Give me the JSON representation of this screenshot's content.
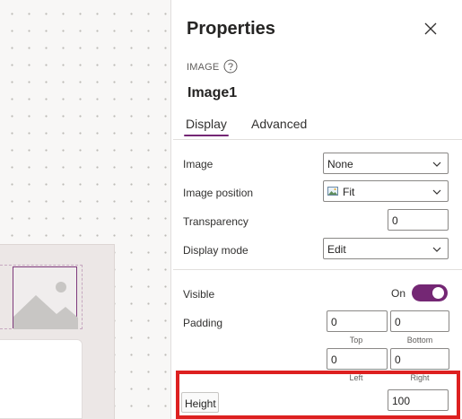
{
  "pane": {
    "title": "Properties",
    "control_type": "IMAGE",
    "control_name": "Image1",
    "tabs": [
      "Display",
      "Advanced"
    ],
    "active_tab": "Display"
  },
  "props": {
    "image": {
      "label": "Image",
      "value": "None"
    },
    "image_position": {
      "label": "Image position",
      "value": "Fit"
    },
    "transparency": {
      "label": "Transparency",
      "value": "0"
    },
    "display_mode": {
      "label": "Display mode",
      "value": "Edit"
    },
    "visible": {
      "label": "Visible",
      "state_text": "On",
      "on": true
    },
    "padding": {
      "label": "Padding",
      "top": "0",
      "bottom": "0",
      "left": "0",
      "right": "0",
      "captions": {
        "top": "Top",
        "bottom": "Bottom",
        "left": "Left",
        "right": "Right"
      }
    },
    "height": {
      "label": "Height",
      "value": "100"
    }
  },
  "icons": {
    "close": "close-icon",
    "help": "help-circle-icon",
    "chevron": "chevron-down-icon",
    "picture": "picture-icon",
    "image_placeholder": "image-placeholder-icon"
  },
  "colors": {
    "accent": "#742774",
    "highlight": "#dd2020",
    "placeholder": "#c8c6c4",
    "canvas_dot": "#bdbab6"
  }
}
